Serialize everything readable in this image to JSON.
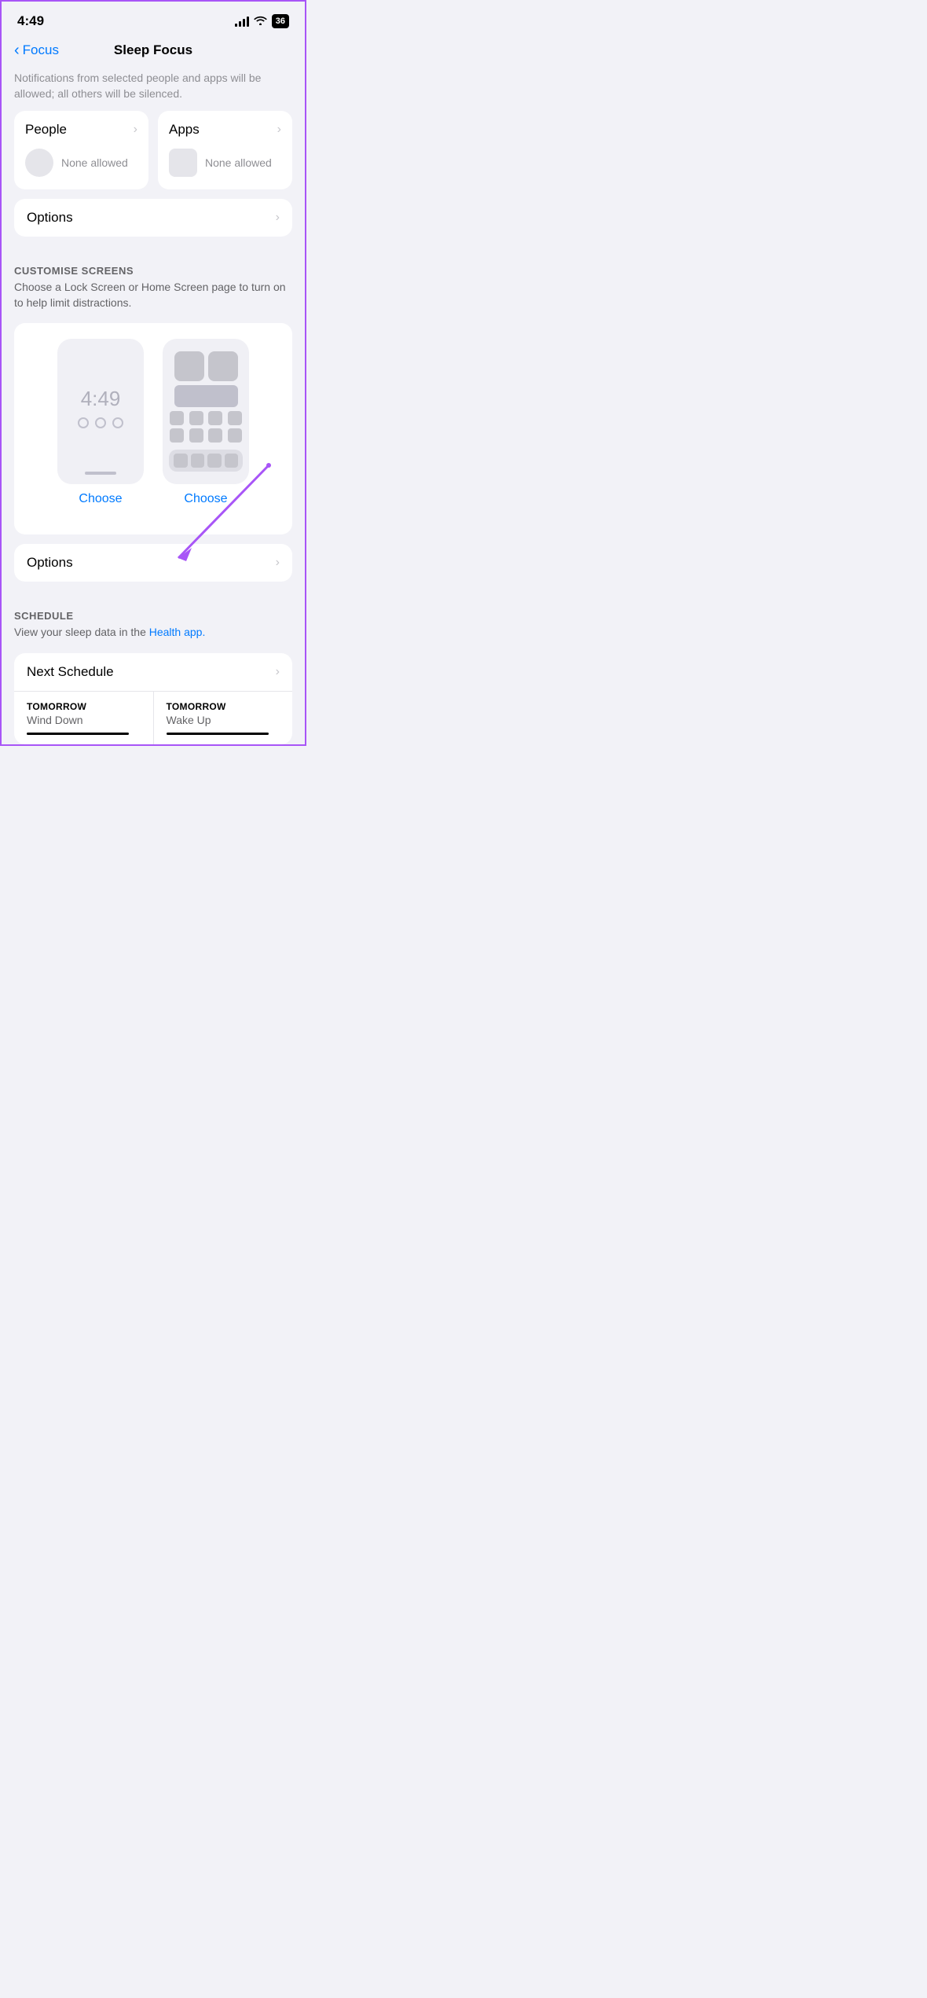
{
  "statusBar": {
    "time": "4:49",
    "battery": "36"
  },
  "navBar": {
    "backLabel": "Focus",
    "title": "Sleep Focus"
  },
  "intro": {
    "text": "Notifications from selected people and apps will be allowed; all others will be silenced."
  },
  "notifications": {
    "peopleCard": {
      "title": "People",
      "subText": "None allowed"
    },
    "appsCard": {
      "title": "Apps",
      "subText": "None allowed"
    }
  },
  "optionsRow": {
    "label": "Options"
  },
  "customiseScreens": {
    "sectionTitle": "CUSTOMISE SCREENS",
    "sectionDesc": "Choose a Lock Screen or Home Screen page to turn on to help limit distractions.",
    "lockScreen": {
      "time": "4:49",
      "chooseLabel": "Choose"
    },
    "homeScreen": {
      "chooseLabel": "Choose"
    }
  },
  "optionsAnnotated": {
    "label": "Options"
  },
  "schedule": {
    "sectionTitle": "SCHEDULE",
    "sectionDesc": "View your sleep data in the ",
    "healthLinkText": "Health app.",
    "nextScheduleLabel": "Next Schedule",
    "items": [
      {
        "day": "TOMORROW",
        "name": "Wind Down"
      },
      {
        "day": "TOMORROW",
        "name": "Wake Up"
      }
    ]
  },
  "icons": {
    "chevronRight": "›",
    "chevronLeft": "‹"
  },
  "colors": {
    "blue": "#007aff",
    "purple": "#a855f7",
    "gray": "#8e8e93",
    "lightGray": "#e5e5ea"
  }
}
